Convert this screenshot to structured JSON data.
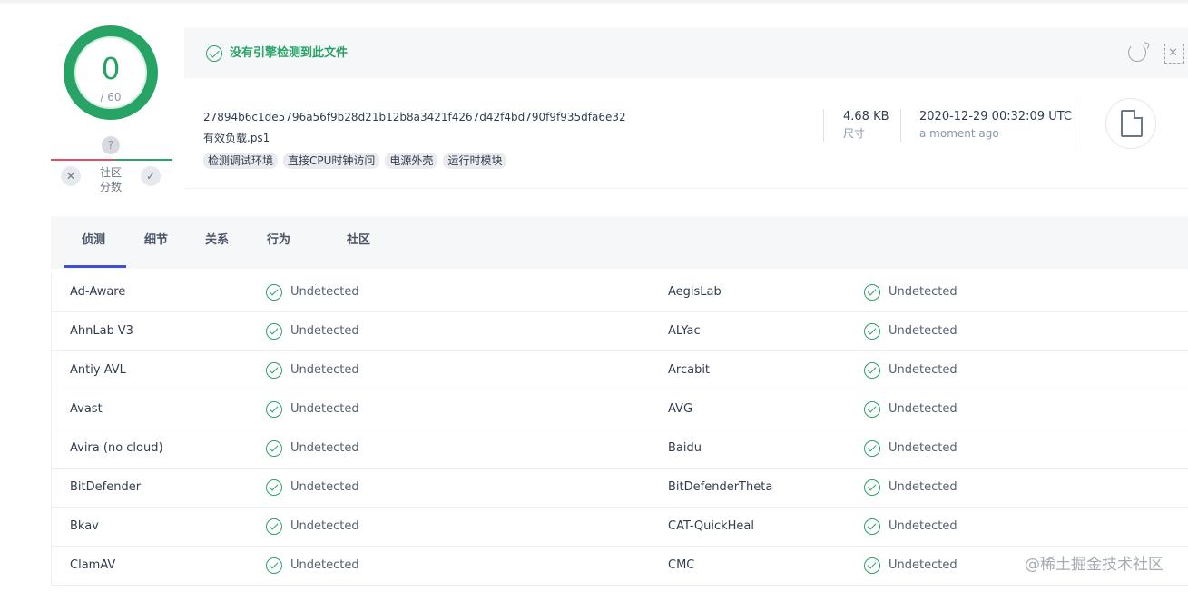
{
  "score": {
    "value": "0",
    "total": "/ 60"
  },
  "community": {
    "help": "?",
    "label_line1": "社区",
    "label_line2": "分数",
    "down": "✕",
    "up": "✓"
  },
  "banner": {
    "message": "没有引擎检测到此文件"
  },
  "file": {
    "hash": "27894b6c1de5796a56f9b28d21b12b8a3421f4267d42f4bd790f9f935dfa6e32",
    "name": "有效负载.ps1",
    "tags": [
      "检测调试环境",
      "直接CPU时钟访问",
      "电源外壳",
      "运行时模块"
    ],
    "size_value": "4.68 KB",
    "size_label": "尺寸",
    "date_value": "2020-12-29 00:32:09 UTC",
    "date_label": "a moment ago"
  },
  "tabs": [
    "侦测",
    "细节",
    "关系",
    "行为",
    "社区"
  ],
  "active_tab": "侦测",
  "detections": [
    {
      "left_engine": "Ad-Aware",
      "left_result": "Undetected",
      "right_engine": "AegisLab",
      "right_result": "Undetected"
    },
    {
      "left_engine": "AhnLab-V3",
      "left_result": "Undetected",
      "right_engine": "ALYac",
      "right_result": "Undetected"
    },
    {
      "left_engine": "Antiy-AVL",
      "left_result": "Undetected",
      "right_engine": "Arcabit",
      "right_result": "Undetected"
    },
    {
      "left_engine": "Avast",
      "left_result": "Undetected",
      "right_engine": "AVG",
      "right_result": "Undetected"
    },
    {
      "left_engine": "Avira (no cloud)",
      "left_result": "Undetected",
      "right_engine": "Baidu",
      "right_result": "Undetected"
    },
    {
      "left_engine": "BitDefender",
      "left_result": "Undetected",
      "right_engine": "BitDefenderTheta",
      "right_result": "Undetected"
    },
    {
      "left_engine": "Bkav",
      "left_result": "Undetected",
      "right_engine": "CAT-QuickHeal",
      "right_result": "Undetected"
    },
    {
      "left_engine": "ClamAV",
      "left_result": "Undetected",
      "right_engine": "CMC",
      "right_result": "Undetected"
    }
  ],
  "watermark": "@稀土掘金技术社区",
  "colors": {
    "clean": "#27a366",
    "malicious": "#e0515e",
    "tab_active": "#3c4fd6"
  },
  "icons": [
    "check-circle-icon",
    "reload-icon",
    "scan-icon",
    "file-icon",
    "help-icon",
    "thumbs-down-icon",
    "thumbs-up-icon"
  ]
}
